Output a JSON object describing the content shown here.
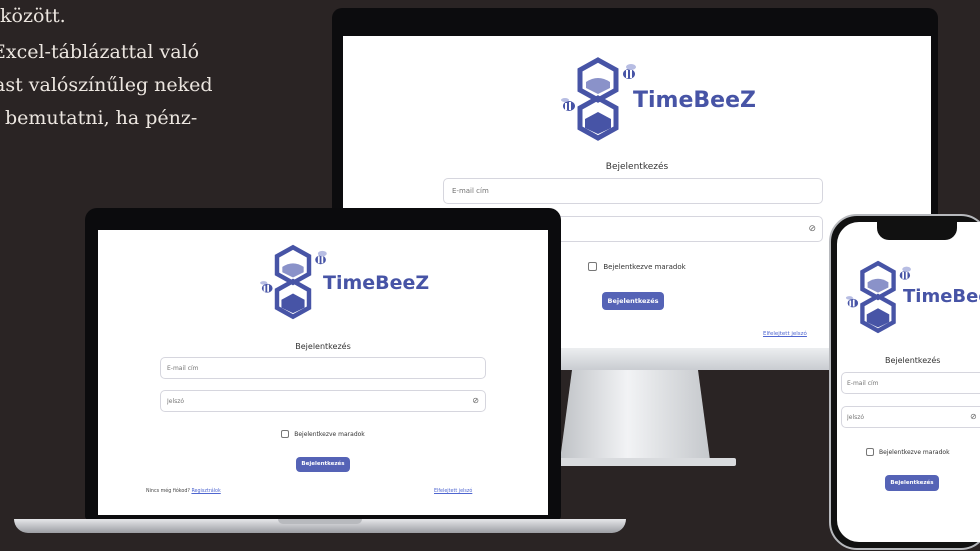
{
  "article": {
    "lines": [
      "között.",
      "Excel-táblázattal való",
      "ast valószínűleg neked",
      "bemutatni, ha pénz-"
    ]
  },
  "login": {
    "brand": "TimeBeeZ",
    "title": "Bejelentkezés",
    "email_placeholder": "E-mail cím",
    "password_placeholder": "Jelszó",
    "remember_label": "Bejelentkezve maradok",
    "submit_label": "Bejelentkezés",
    "forgot_label": "Elfelejtett jelszó",
    "no_account_label": "Nincs még fiókod?",
    "register_label": "Regisztrálok"
  },
  "colors": {
    "brand": "#4754a6",
    "button": "#5563b6",
    "link": "#4f66d0",
    "background": "#2a2424"
  },
  "icons": {
    "password_toggle": "eye-slash-icon",
    "logo": "hourglass-bee-icon"
  }
}
